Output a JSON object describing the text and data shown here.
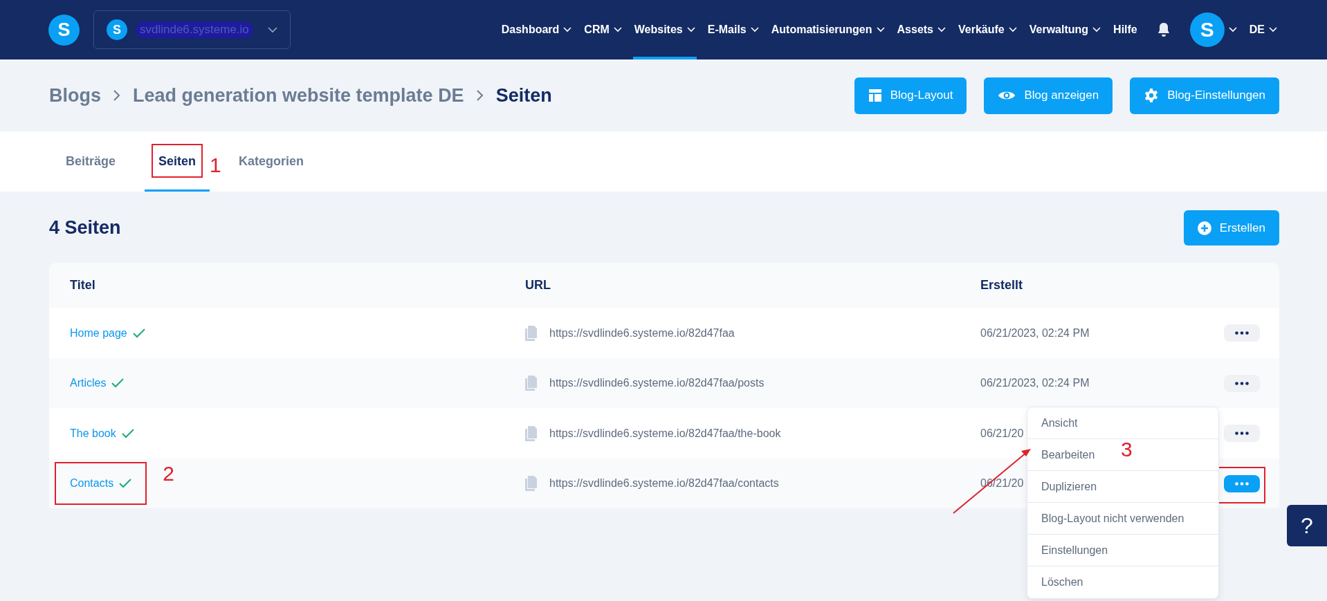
{
  "nav": {
    "logo": "S",
    "workspace_logo": "S",
    "workspace": "svdlinde6.systeme.io",
    "avatar": "S",
    "items": [
      {
        "label": "Dashboard",
        "selected": false,
        "dropdown": true
      },
      {
        "label": "CRM",
        "selected": false,
        "dropdown": true
      },
      {
        "label": "Websites",
        "selected": true,
        "dropdown": true
      },
      {
        "label": "E-Mails",
        "selected": false,
        "dropdown": true
      },
      {
        "label": "Automatisierungen",
        "selected": false,
        "dropdown": true
      },
      {
        "label": "Assets",
        "selected": false,
        "dropdown": true
      },
      {
        "label": "Verkäufe",
        "selected": false,
        "dropdown": true
      },
      {
        "label": "Verwaltung",
        "selected": false,
        "dropdown": true
      },
      {
        "label": "Hilfe",
        "selected": false,
        "dropdown": false
      }
    ],
    "language": "DE"
  },
  "breadcrumb": [
    "Blogs",
    "Lead generation website template DE",
    "Seiten"
  ],
  "header_buttons": [
    {
      "kind": "layout",
      "label": "Blog-Layout"
    },
    {
      "kind": "view",
      "label": "Blog anzeigen"
    },
    {
      "kind": "settings",
      "label": "Blog-Einstellungen"
    }
  ],
  "tabs": [
    {
      "label": "Beiträge",
      "selected": false,
      "highlighted": false
    },
    {
      "label": "Seiten",
      "selected": true,
      "highlighted": true,
      "annotation": "1"
    },
    {
      "label": "Kategorien",
      "selected": false,
      "highlighted": false
    }
  ],
  "count_title": "4 Seiten",
  "create_button": "Erstellen",
  "table": {
    "columns": [
      "Titel",
      "URL",
      "Erstellt"
    ],
    "rows": [
      {
        "title": "Home page",
        "published": true,
        "url": "https://svdlinde6.systeme.io/82d47faa",
        "created": "06/21/2023, 02:24 PM",
        "highlighted": false,
        "menu_open": false
      },
      {
        "title": "Articles",
        "published": true,
        "url": "https://svdlinde6.systeme.io/82d47faa/posts",
        "created": "06/21/2023, 02:24 PM",
        "highlighted": false,
        "menu_open": false
      },
      {
        "title": "The book",
        "published": true,
        "url": "https://svdlinde6.systeme.io/82d47faa/the-book",
        "created": "06/21/20",
        "highlighted": false,
        "menu_open": false
      },
      {
        "title": "Contacts",
        "published": true,
        "url": "https://svdlinde6.systeme.io/82d47faa/contacts",
        "created": "06/21/20",
        "highlighted": true,
        "annotation": "2",
        "menu_open": true
      }
    ]
  },
  "row_menu": {
    "items": [
      "Ansicht",
      "Bearbeiten",
      "Duplizieren",
      "Blog-Layout nicht verwenden",
      "Einstellungen",
      "Löschen"
    ],
    "annotation": "3"
  },
  "help_button": "?"
}
